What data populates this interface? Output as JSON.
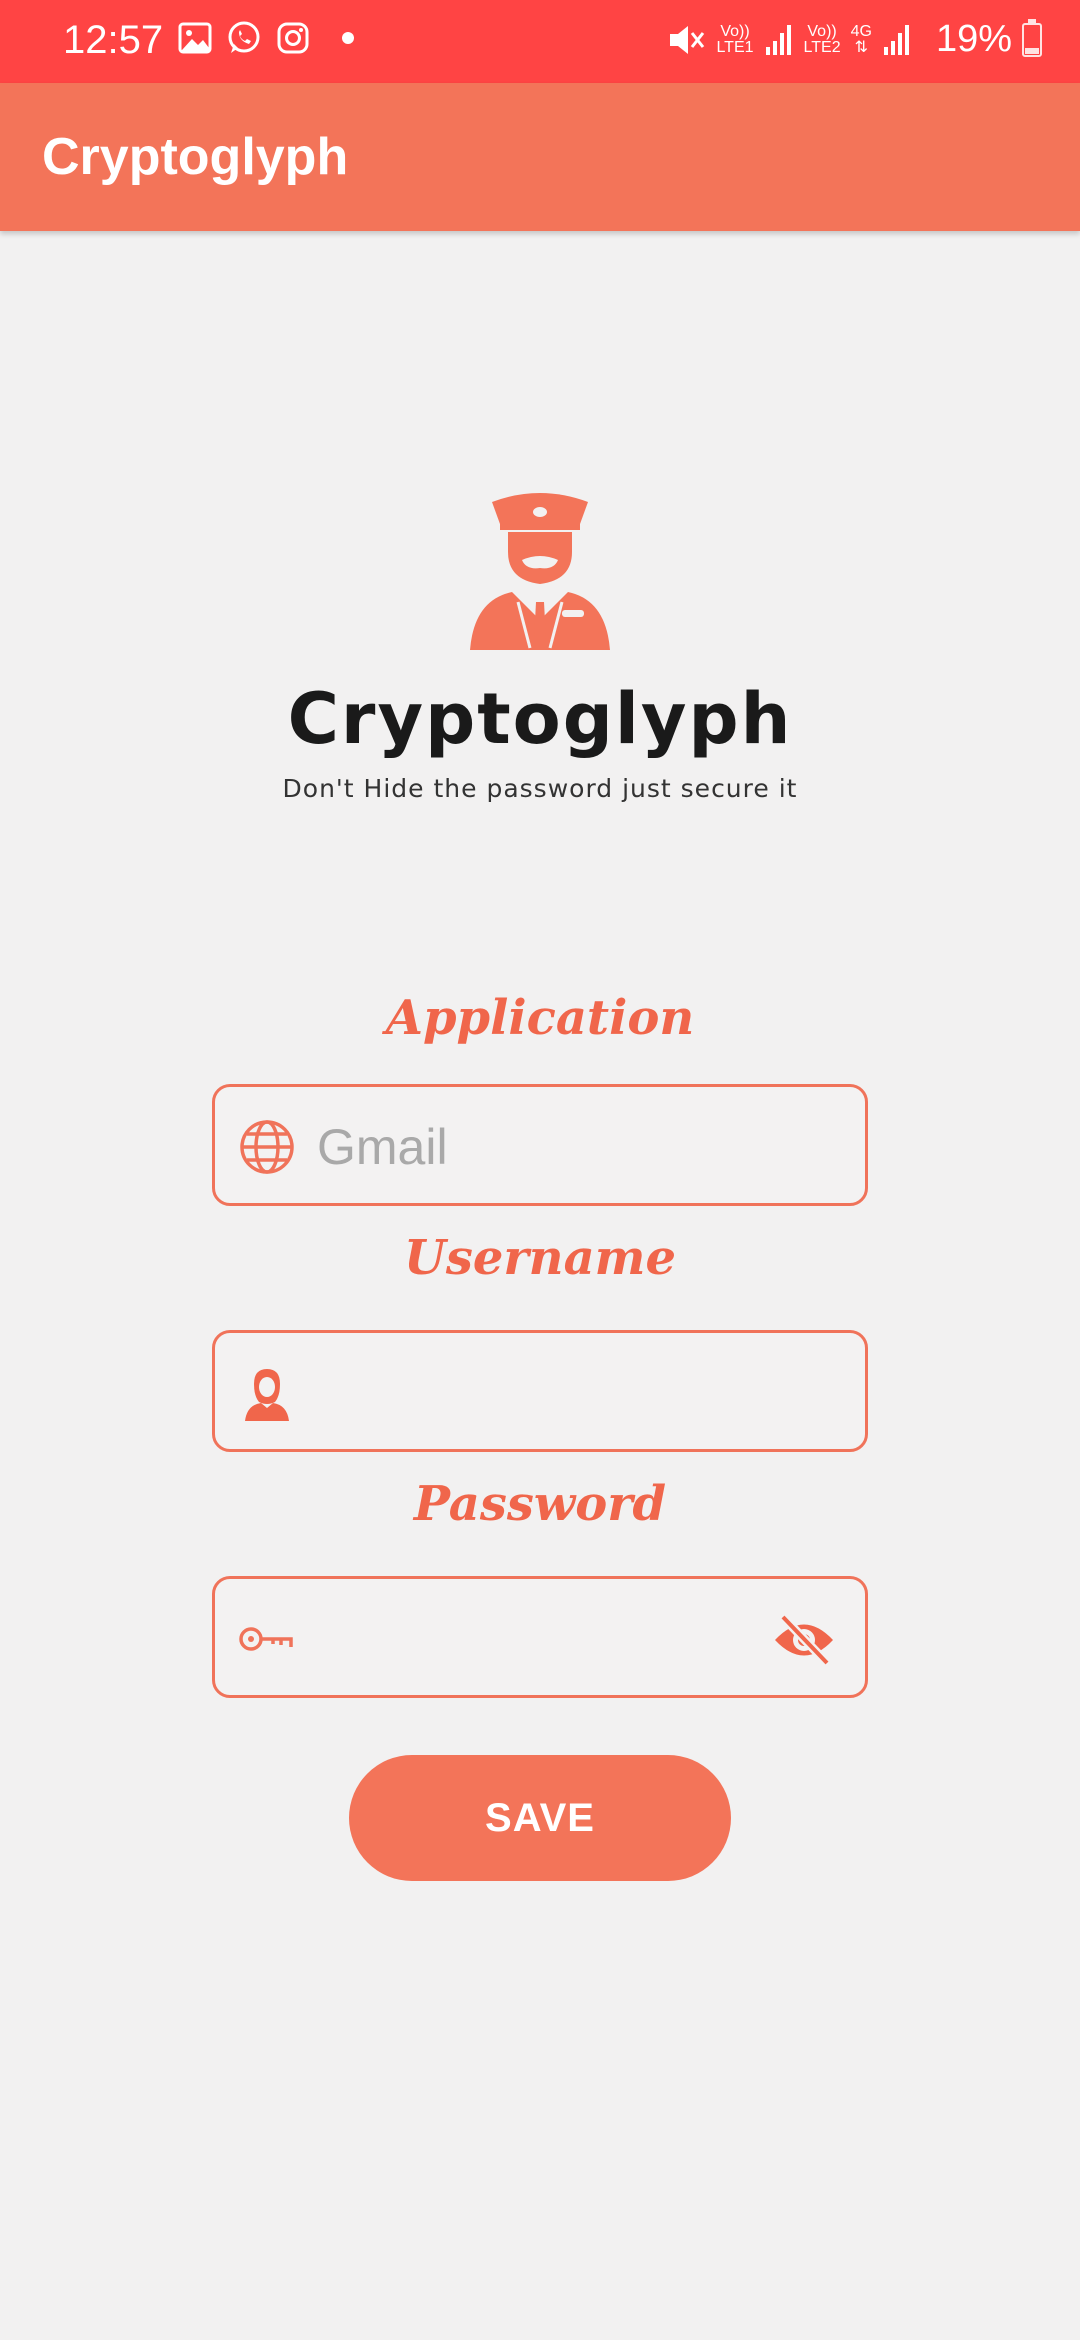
{
  "status_bar": {
    "time": "12:57",
    "left_icons": [
      "gallery-icon",
      "whatsapp-icon",
      "instagram-icon"
    ],
    "network": [
      {
        "top": "Vo))",
        "bottom": "LTE1"
      },
      {
        "top": "Vo))",
        "bottom": "LTE2"
      },
      {
        "top": "4G",
        "bottom": ""
      }
    ],
    "battery_percent": "19%",
    "battery_level": 0.19
  },
  "app_bar": {
    "title": "Cryptoglyph"
  },
  "brand": {
    "name": "Cryptoglyph",
    "tagline": "Don't Hide the password just secure it"
  },
  "form": {
    "application": {
      "label": "Application",
      "placeholder": "Gmail",
      "value": "",
      "icon": "globe-icon"
    },
    "username": {
      "label": "Username",
      "placeholder": "",
      "value": "",
      "icon": "user-icon"
    },
    "password": {
      "label": "Password",
      "placeholder": "",
      "value": "",
      "icon": "key-icon",
      "toggle_icon": "eye-off-icon"
    },
    "save_label": "SAVE"
  },
  "colors": {
    "status_bar": "#ff4444",
    "app_bar": "#f37459",
    "accent": "#f0664b",
    "background": "#f2f1f1"
  }
}
